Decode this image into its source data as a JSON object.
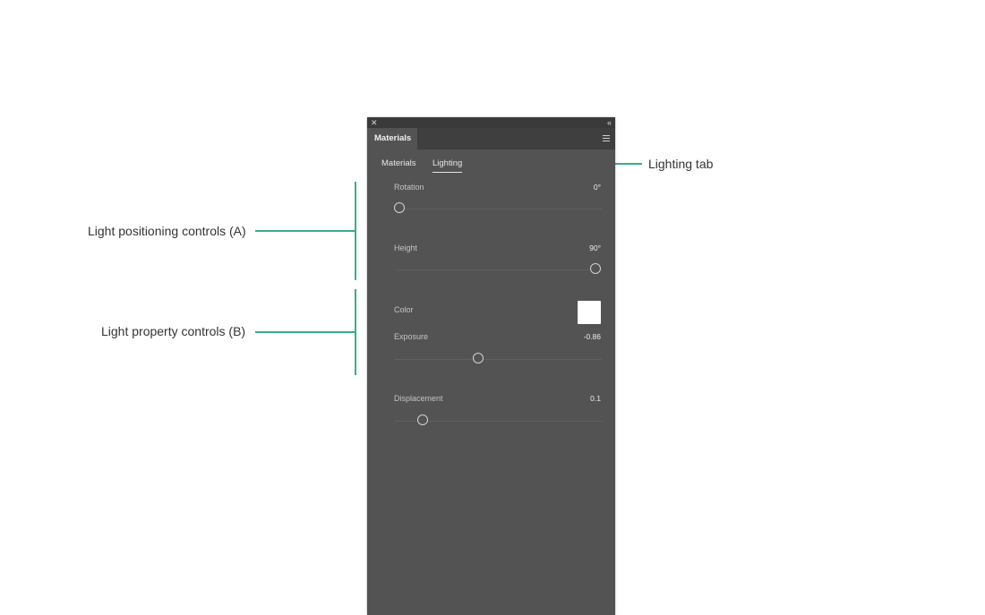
{
  "panel": {
    "title_tab": "Materials",
    "subtabs": {
      "materials": "Materials",
      "lighting": "Lighting"
    },
    "controls": {
      "rotation": {
        "label": "Rotation",
        "value": "0°",
        "position": 0.0
      },
      "height": {
        "label": "Height",
        "value": "90°",
        "position": 1.0
      },
      "color": {
        "label": "Color",
        "swatch": "#ffffff"
      },
      "exposure": {
        "label": "Exposure",
        "value": "-0.86",
        "position": 0.4
      },
      "displacement": {
        "label": "Displacement",
        "value": "0.1",
        "position": 0.12
      }
    }
  },
  "annotations": {
    "lighting_tab": "Lighting tab",
    "positioning": "Light positioning controls (A)",
    "property": "Light property controls (B)"
  },
  "colors": {
    "panel_bg": "#535353",
    "accent": "#3bad8a"
  }
}
